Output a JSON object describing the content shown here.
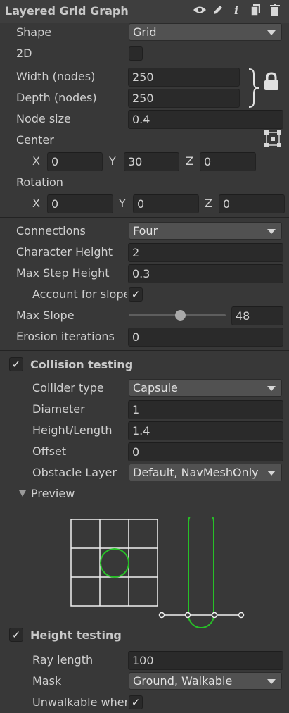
{
  "header": {
    "title": "Layered Grid Graph",
    "icons": [
      "eye-icon",
      "pencil-icon",
      "info-icon",
      "copy-icon",
      "trash-icon"
    ]
  },
  "grid": {
    "shape_label": "Shape",
    "shape_value": "Grid",
    "twod_label": "2D",
    "twod_checked": false,
    "width_label": "Width (nodes)",
    "width_value": "250",
    "depth_label": "Depth (nodes)",
    "depth_value": "250",
    "node_size_label": "Node size",
    "node_size_value": "0.4",
    "center_label": "Center",
    "center": {
      "x_label": "X",
      "x": "0",
      "y_label": "Y",
      "y": "30",
      "z_label": "Z",
      "z": "0"
    },
    "rotation_label": "Rotation",
    "rotation": {
      "x_label": "X",
      "x": "0",
      "y_label": "Y",
      "y": "0",
      "z_label": "Z",
      "z": "0"
    }
  },
  "connections": {
    "connections_label": "Connections",
    "connections_value": "Four",
    "char_height_label": "Character Height",
    "char_height_value": "2",
    "max_step_label": "Max Step Height",
    "max_step_value": "0.3",
    "account_slope_label": "Account for slope",
    "account_slope_checked": true,
    "max_slope_label": "Max Slope",
    "max_slope_value": "48",
    "max_slope_fraction": 0.533,
    "erosion_label": "Erosion iterations",
    "erosion_value": "0"
  },
  "collision": {
    "title": "Collision testing",
    "enabled": true,
    "collider_type_label": "Collider type",
    "collider_type_value": "Capsule",
    "diameter_label": "Diameter",
    "diameter_value": "1",
    "height_label": "Height/Length",
    "height_value": "1.4",
    "offset_label": "Offset",
    "offset_value": "0",
    "obstacle_label": "Obstacle Layer",
    "obstacle_value": "Default, NavMeshOnly",
    "preview_label": "Preview",
    "preview_color": "#27c027"
  },
  "height_testing": {
    "title": "Height testing",
    "enabled": true,
    "ray_length_label": "Ray length",
    "ray_length_value": "100",
    "mask_label": "Mask",
    "mask_value": "Ground, Walkable",
    "unwalkable_label": "Unwalkable when no ground",
    "unwalkable_checked": true
  }
}
